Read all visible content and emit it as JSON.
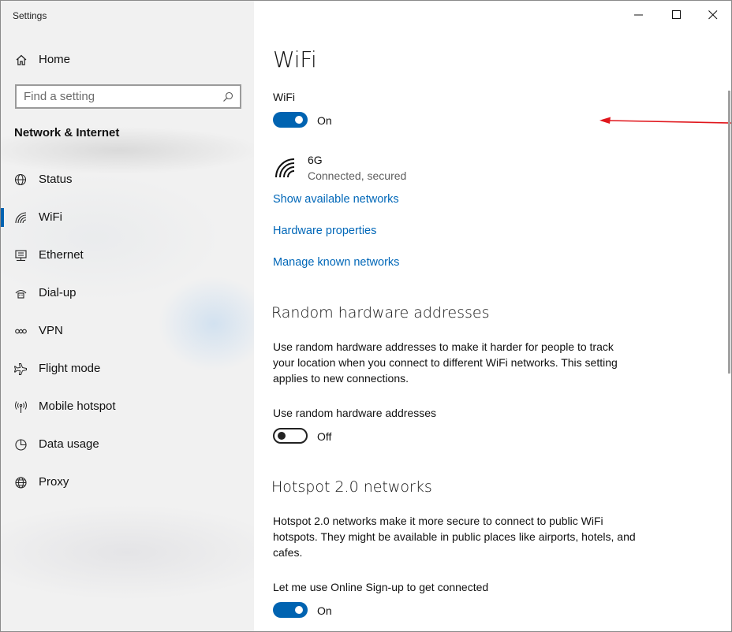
{
  "window": {
    "title": "Settings"
  },
  "sidebar": {
    "home_label": "Home",
    "search_placeholder": "Find a setting",
    "section_title": "Network & Internet",
    "items": [
      {
        "label": "Status",
        "icon": "globe-status-icon"
      },
      {
        "label": "WiFi",
        "icon": "wifi-icon",
        "selected": true
      },
      {
        "label": "Ethernet",
        "icon": "ethernet-icon"
      },
      {
        "label": "Dial-up",
        "icon": "dial-up-icon"
      },
      {
        "label": "VPN",
        "icon": "vpn-icon"
      },
      {
        "label": "Flight mode",
        "icon": "airplane-icon"
      },
      {
        "label": "Mobile hotspot",
        "icon": "hotspot-icon"
      },
      {
        "label": "Data usage",
        "icon": "data-usage-icon"
      },
      {
        "label": "Proxy",
        "icon": "globe-icon"
      }
    ]
  },
  "content": {
    "title": "WiFi",
    "wifi_label": "WiFi",
    "wifi_state": "On",
    "network": {
      "name": "6G",
      "status": "Connected, secured"
    },
    "links": {
      "show_networks": "Show available networks",
      "hardware_props": "Hardware properties",
      "manage_known": "Manage known networks"
    },
    "random_hw": {
      "heading": "Random hardware addresses",
      "description": "Use random hardware addresses to make it harder for people to track your location when you connect to different WiFi networks. This setting applies to new connections.",
      "toggle_label": "Use random hardware addresses",
      "toggle_state": "Off"
    },
    "hotspot20": {
      "heading": "Hotspot 2.0 networks",
      "description": "Hotspot 2.0 networks make it more secure to connect to public WiFi hotspots. They might be available in public places like airports, hotels, and cafes.",
      "toggle_label": "Let me use Online Sign-up to get connected",
      "toggle_state": "On"
    }
  },
  "colors": {
    "accent": "#0063b1",
    "link": "#0067b8",
    "annotation_arrow": "#e0161c"
  }
}
